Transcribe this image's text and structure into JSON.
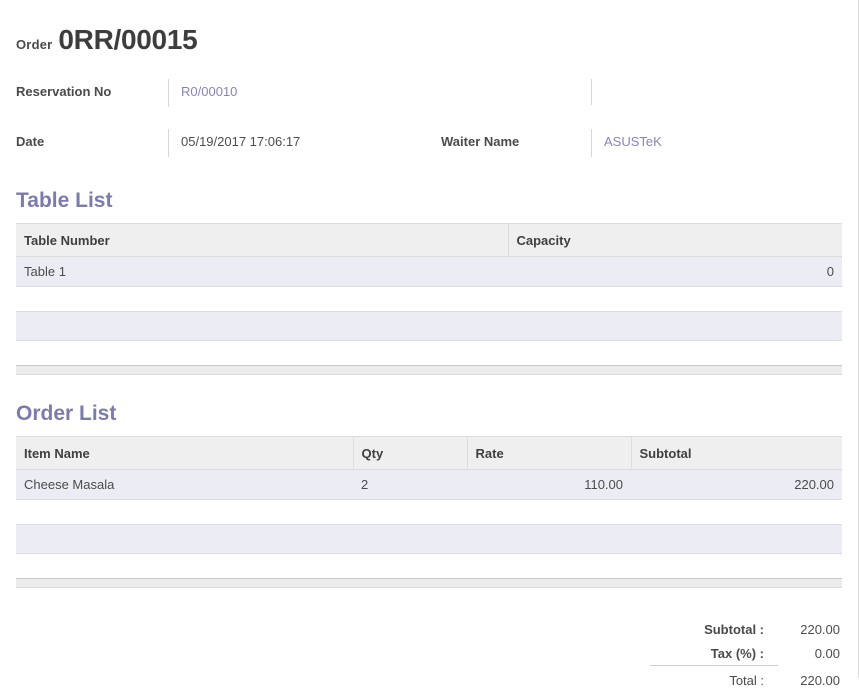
{
  "document": {
    "title_label": "Order",
    "title_value": "0RR/00015"
  },
  "fields": {
    "reservation_no": {
      "label": "Reservation No",
      "value": "R0/00010"
    },
    "date": {
      "label": "Date",
      "value": "05/19/2017 17:06:17"
    },
    "waiter_name": {
      "label": "Waiter Name",
      "value": "ASUSTeK"
    }
  },
  "table_list": {
    "heading": "Table List",
    "columns": [
      "Table Number",
      "Capacity"
    ],
    "rows": [
      {
        "table_number": "Table 1",
        "capacity": "0"
      }
    ]
  },
  "order_list": {
    "heading": "Order List",
    "columns": [
      "Item Name",
      "Qty",
      "Rate",
      "Subtotal"
    ],
    "rows": [
      {
        "item_name": "Cheese Masala",
        "qty": "2",
        "rate": "110.00",
        "subtotal": "220.00"
      }
    ]
  },
  "totals": {
    "subtotal_label": "Subtotal :",
    "subtotal_value": "220.00",
    "tax_label": "Tax (%) :",
    "tax_value": "0.00",
    "total_label": "Total :",
    "total_value": "220.00"
  },
  "colors": {
    "heading": "#7c7bad",
    "link": "#8585bd",
    "table_header_bg": "#efefef",
    "table_row_bg": "#ececf5",
    "table_footer_bg": "#ececec",
    "text": "#4c4c4c"
  }
}
